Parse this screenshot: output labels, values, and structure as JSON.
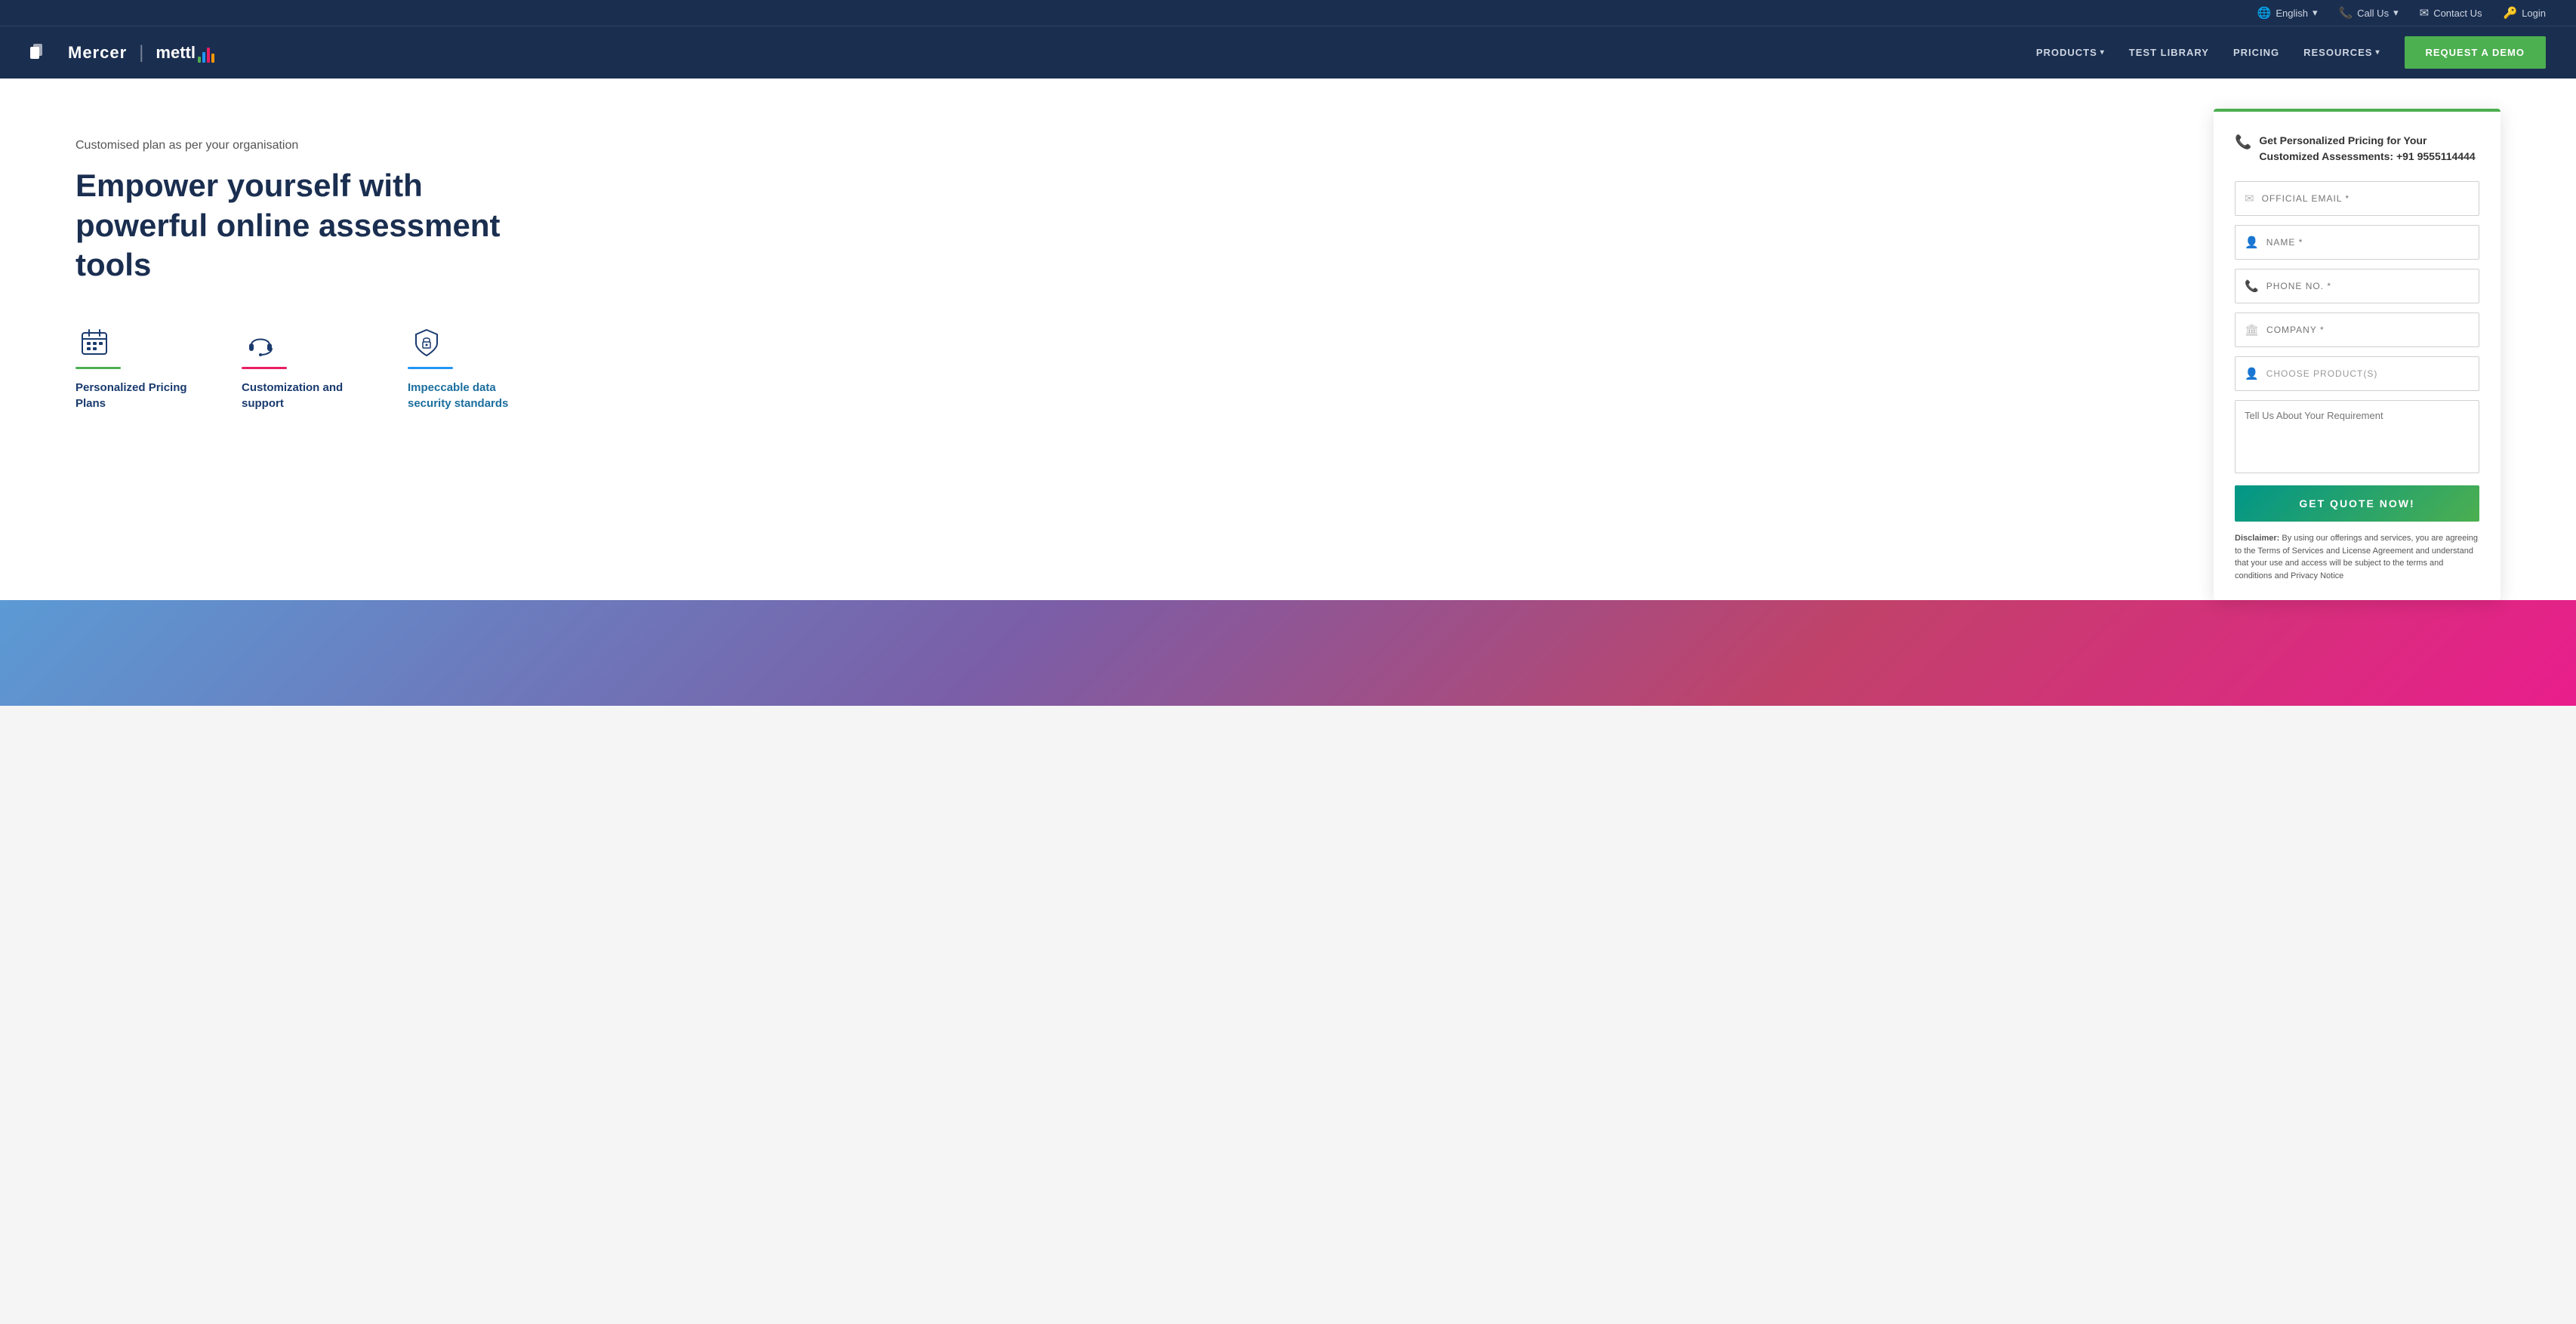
{
  "topbar": {
    "language": {
      "icon": "🌐",
      "label": "English",
      "caret": "▾"
    },
    "call": {
      "icon": "📞",
      "label": "Call Us",
      "caret": "▾"
    },
    "contact": {
      "icon": "✉",
      "label": "Contact Us"
    },
    "login": {
      "icon": "🔑",
      "label": "Login"
    }
  },
  "nav": {
    "logo_mercer": "Mercer",
    "logo_divider": "|",
    "logo_mettl": "mettl",
    "links": [
      {
        "label": "PRODUCTS",
        "has_dropdown": true
      },
      {
        "label": "TEST LIBRARY",
        "has_dropdown": false
      },
      {
        "label": "PRICING",
        "has_dropdown": false
      },
      {
        "label": "RESOURCES",
        "has_dropdown": true
      }
    ],
    "cta_label": "REQUEST A DEMO"
  },
  "hero": {
    "subtitle": "Customised plan as per your organisation",
    "title": "Empower yourself with powerful online assessment tools",
    "features": [
      {
        "icon": "📅",
        "underline_color": "#4caf50",
        "label": "Personalized Pricing Plans"
      },
      {
        "icon": "🎧",
        "underline_color": "#e91e63",
        "label": "Customization and support"
      },
      {
        "icon": "🔒",
        "underline_color": "#2196f3",
        "label": "Impeccable data security standards"
      }
    ]
  },
  "form": {
    "header_text": "Get Personalized Pricing for Your Customized Assessments: +91 9555114444",
    "fields": {
      "email_placeholder": "OFFICIAL EMAIL *",
      "name_placeholder": "NAME *",
      "phone_placeholder": "PHONE NO. *",
      "company_placeholder": "COMPANY *",
      "product_placeholder": "CHOOSE PRODUCT(S)"
    },
    "textarea_placeholder": "Tell Us About Your Requirement",
    "submit_label": "GET QUOTE NOW!",
    "disclaimer_bold": "Disclaimer:",
    "disclaimer_text": " By using our offerings and services, you are agreeing to the Terms of Services and License Agreement and understand that your use and access will be subject to the terms and conditions and Privacy Notice"
  }
}
